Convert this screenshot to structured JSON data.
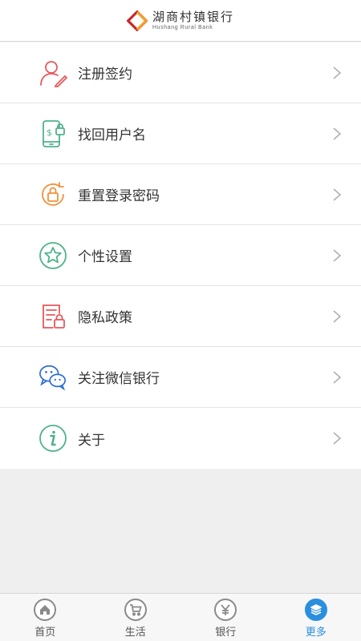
{
  "header": {
    "logo_cn": "湖商村镇银行",
    "logo_en": "Hushang Rural Bank"
  },
  "menu": [
    {
      "label": "注册签约",
      "icon": "user-register-icon",
      "color": "#e8585b"
    },
    {
      "label": "找回用户名",
      "icon": "phone-lock-icon",
      "color": "#4fb38a"
    },
    {
      "label": "重置登录密码",
      "icon": "reset-lock-icon",
      "color": "#f0913b"
    },
    {
      "label": "个性设置",
      "icon": "star-icon",
      "color": "#4fb38a"
    },
    {
      "label": "隐私政策",
      "icon": "privacy-doc-icon",
      "color": "#e8585b"
    },
    {
      "label": "关注微信银行",
      "icon": "wechat-icon",
      "color": "#2e6fd0"
    },
    {
      "label": "关于",
      "icon": "info-icon",
      "color": "#4fb38a"
    }
  ],
  "tabs": [
    {
      "label": "首页",
      "icon": "home-icon",
      "active": false
    },
    {
      "label": "生活",
      "icon": "cart-icon",
      "active": false
    },
    {
      "label": "银行",
      "icon": "yen-icon",
      "active": false
    },
    {
      "label": "更多",
      "icon": "layers-icon",
      "active": true
    }
  ],
  "colors": {
    "accent": "#2a8fde",
    "brand": "#c8282d"
  }
}
